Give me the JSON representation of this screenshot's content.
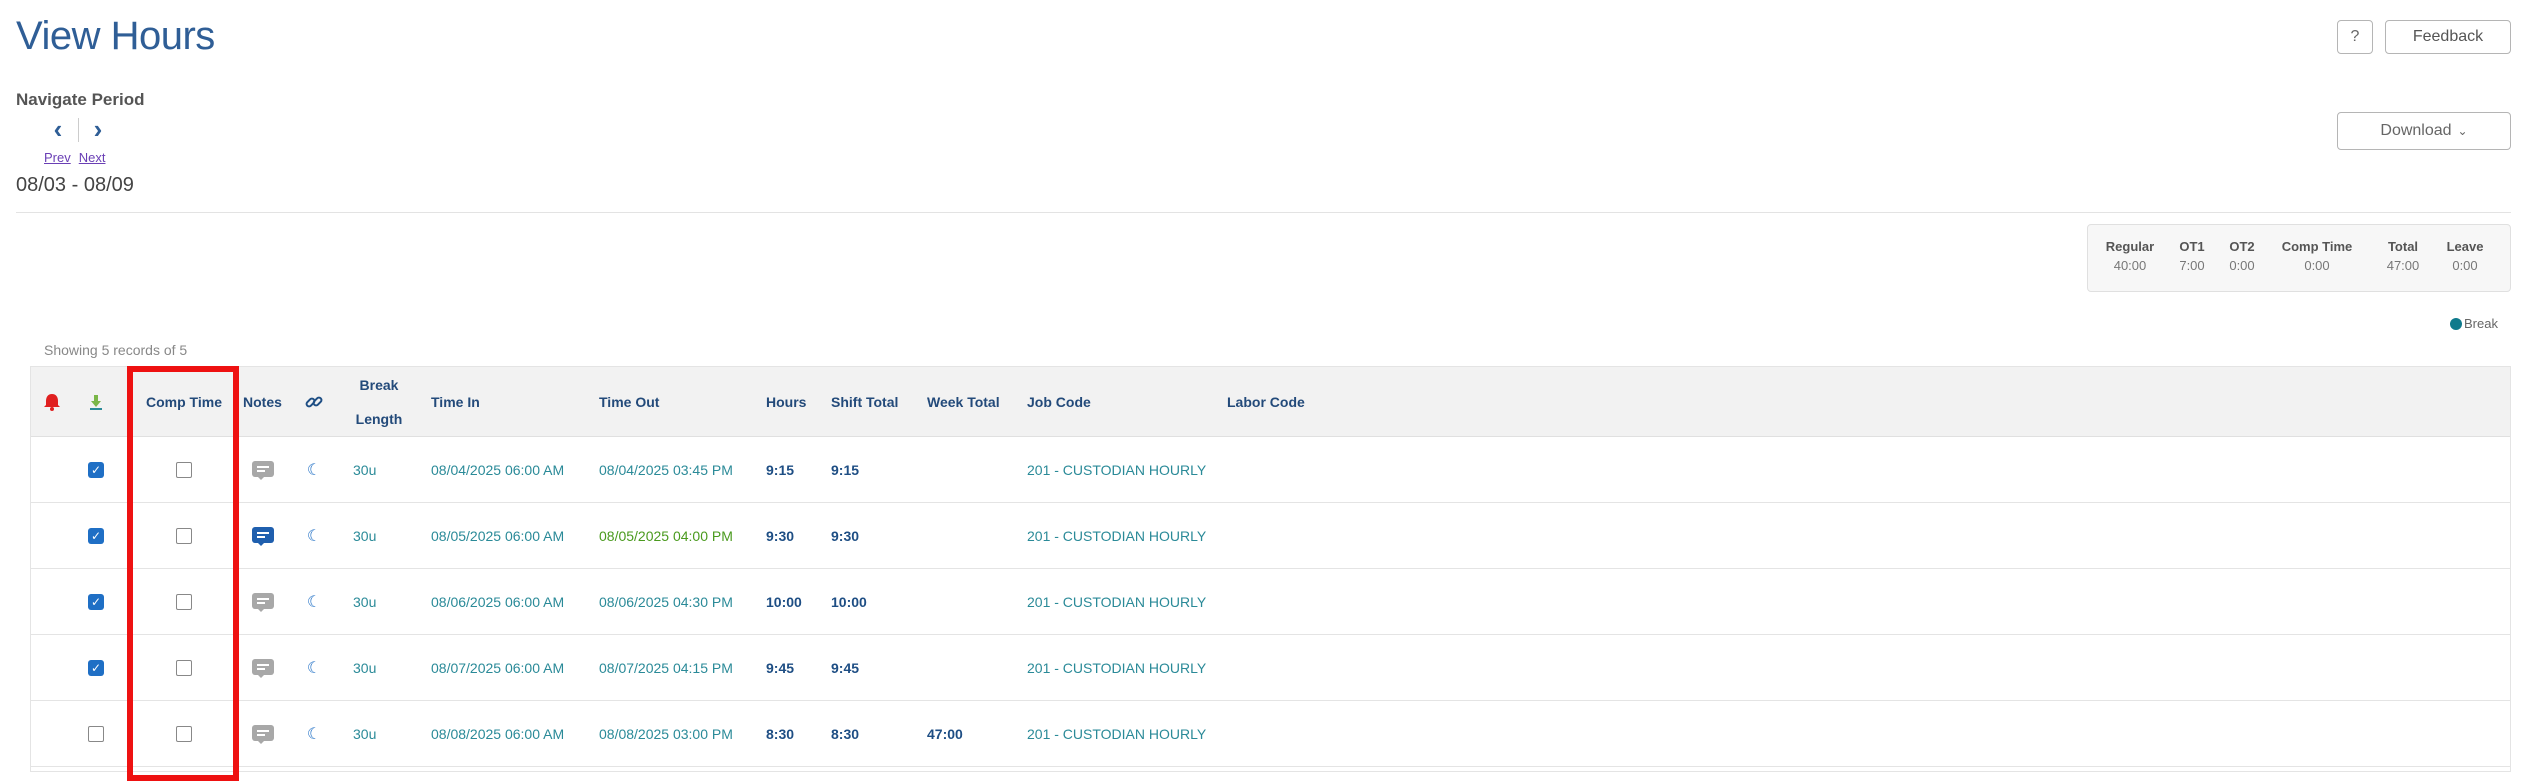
{
  "header": {
    "title": "View Hours",
    "help_label": "?",
    "feedback_label": "Feedback",
    "download_label": "Download",
    "download_caret": "⌄"
  },
  "nav": {
    "label": "Navigate Period",
    "prev_arrow": "‹",
    "next_arrow": "›",
    "prev_link": "Prev",
    "next_link": "Next",
    "period": "08/03 - 08/09"
  },
  "summary": [
    {
      "label": "Regular",
      "value": "40:00"
    },
    {
      "label": "OT1",
      "value": "7:00"
    },
    {
      "label": "OT2",
      "value": "0:00"
    },
    {
      "label": "Comp Time",
      "value": "0:00"
    },
    {
      "label": "Total",
      "value": "47:00"
    },
    {
      "label": "Leave",
      "value": "0:00"
    }
  ],
  "legend": {
    "label": "Break",
    "color": "#0f7a8c"
  },
  "records_text": "Showing 5 records of 5",
  "table": {
    "headers": {
      "alert": "alert-icon",
      "approve": "approval-icon",
      "comp_time": "Comp Time",
      "notes": "Notes",
      "link": "link-icon",
      "break_length": "Break Length",
      "time_in": "Time In",
      "time_out": "Time Out",
      "hours": "Hours",
      "shift_total": "Shift Total",
      "week_total": "Week Total",
      "job_code": "Job Code",
      "labor_code": "Labor Code"
    },
    "rows": [
      {
        "approved": true,
        "comp_time": false,
        "has_note": false,
        "break": "30u",
        "time_in": "08/04/2025 06:00 AM",
        "time_out": "08/04/2025 03:45 PM",
        "time_out_edited": false,
        "hours": "9:15",
        "shift_total": "9:15",
        "week_total": "",
        "job_code": "201 - CUSTODIAN HOURLY",
        "labor_code": ""
      },
      {
        "approved": true,
        "comp_time": false,
        "has_note": true,
        "break": "30u",
        "time_in": "08/05/2025 06:00 AM",
        "time_out": "08/05/2025 04:00 PM",
        "time_out_edited": true,
        "hours": "9:30",
        "shift_total": "9:30",
        "week_total": "",
        "job_code": "201 - CUSTODIAN HOURLY",
        "labor_code": ""
      },
      {
        "approved": true,
        "comp_time": false,
        "has_note": false,
        "break": "30u",
        "time_in": "08/06/2025 06:00 AM",
        "time_out": "08/06/2025 04:30 PM",
        "time_out_edited": false,
        "hours": "10:00",
        "shift_total": "10:00",
        "week_total": "",
        "job_code": "201 - CUSTODIAN HOURLY",
        "labor_code": ""
      },
      {
        "approved": true,
        "comp_time": false,
        "has_note": false,
        "break": "30u",
        "time_in": "08/07/2025 06:00 AM",
        "time_out": "08/07/2025 04:15 PM",
        "time_out_edited": false,
        "hours": "9:45",
        "shift_total": "9:45",
        "week_total": "",
        "job_code": "201 - CUSTODIAN HOURLY",
        "labor_code": ""
      },
      {
        "approved": false,
        "comp_time": false,
        "has_note": false,
        "break": "30u",
        "time_in": "08/08/2025 06:00 AM",
        "time_out": "08/08/2025 03:00 PM",
        "time_out_edited": false,
        "hours": "8:30",
        "shift_total": "8:30",
        "week_total": "47:00",
        "job_code": "201 - CUSTODIAN HOURLY",
        "labor_code": ""
      }
    ]
  },
  "colors": {
    "title": "#2f5e96",
    "teal_text": "#2a8a98",
    "edited_text": "#4a9a1e",
    "highlight": "#ee1111",
    "check": "#1f6fc5",
    "alert": "#e02020"
  }
}
